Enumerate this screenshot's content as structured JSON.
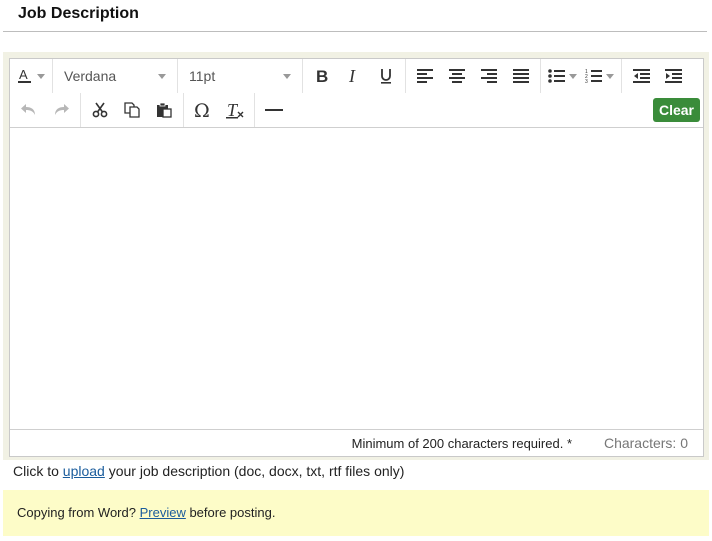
{
  "section": {
    "title": "Job Description"
  },
  "toolbar": {
    "font_family": "Verdana",
    "font_size": "11pt",
    "clear_label": "Clear",
    "row1_icons": [
      "font-color-icon",
      "bold-icon",
      "italic-icon",
      "underline-icon",
      "align-left-icon",
      "align-center-icon",
      "align-right-icon",
      "align-justify-icon",
      "bullet-list-icon",
      "numbered-list-icon",
      "outdent-icon",
      "indent-icon"
    ],
    "row2_icons": [
      "undo-icon",
      "redo-icon",
      "cut-icon",
      "copy-icon",
      "paste-icon",
      "special-character-icon",
      "clear-formatting-icon",
      "horizontal-rule-icon"
    ]
  },
  "status": {
    "min_required": "Minimum of 200 characters required. *",
    "characters": "Characters: 0"
  },
  "upload": {
    "prefix": "Click to ",
    "link": "upload",
    "suffix": " your job description (doc, docx, txt, rtf files only)"
  },
  "word_note": {
    "prefix": "Copying from Word? ",
    "link": "Preview",
    "suffix": " before posting."
  },
  "colors": {
    "clear_button": "#3a8c3a",
    "note_background": "#fdfcc8",
    "link": "#1a5c9c"
  }
}
